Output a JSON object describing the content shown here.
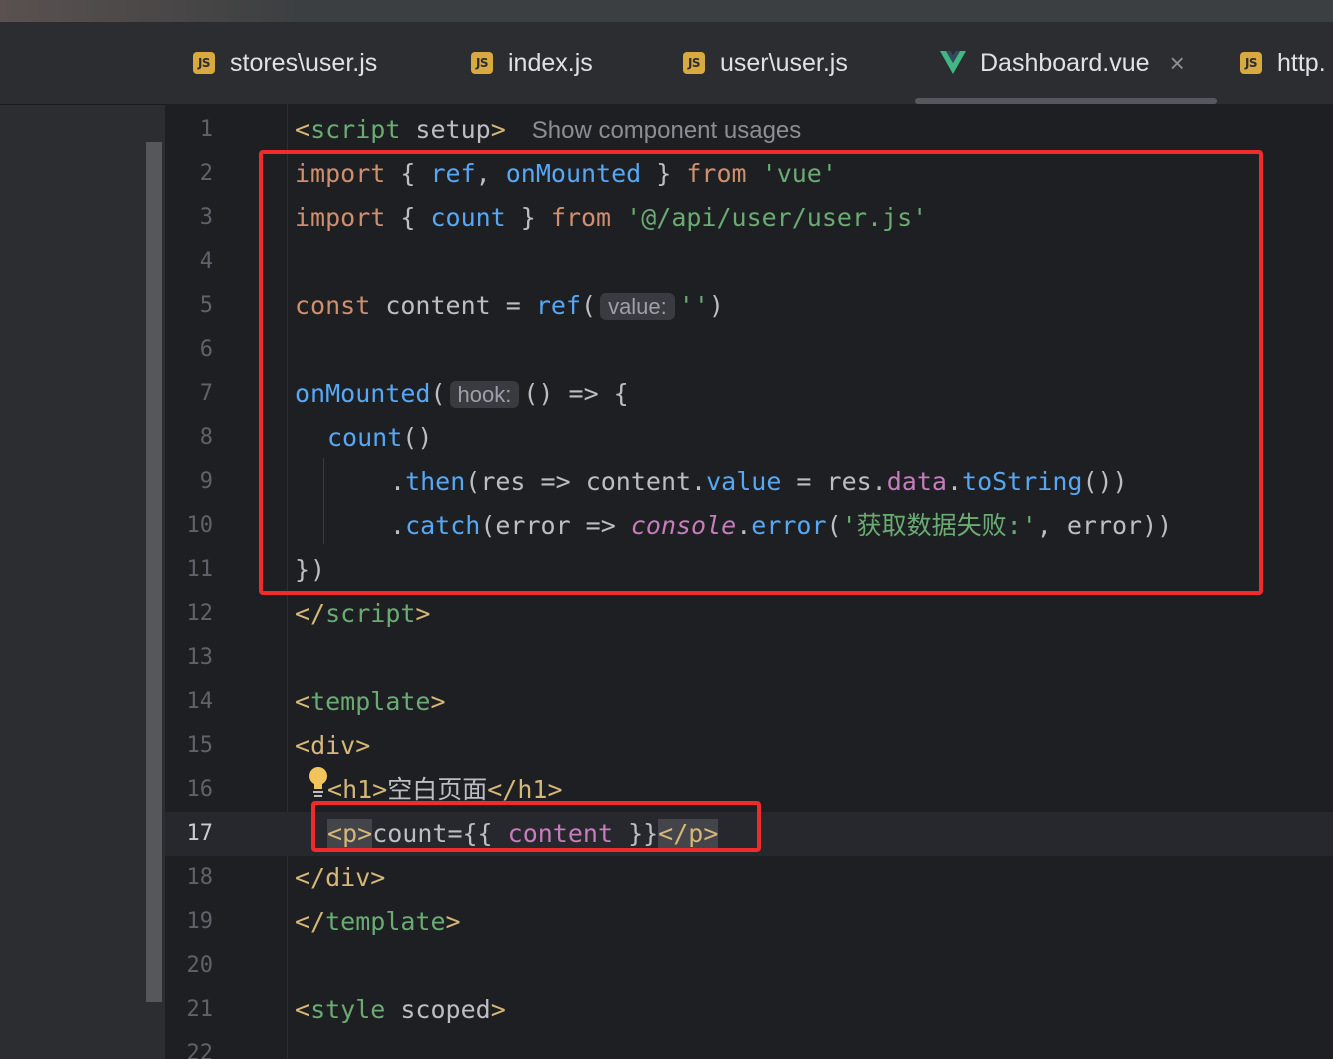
{
  "tabs": [
    {
      "label": "stores\\user.js",
      "icon": "js-file-icon",
      "active": false
    },
    {
      "label": "index.js",
      "icon": "js-file-icon",
      "active": false
    },
    {
      "label": "user\\user.js",
      "icon": "js-file-icon",
      "active": false
    },
    {
      "label": "Dashboard.vue",
      "icon": "vue-file-icon",
      "active": true
    },
    {
      "label": "http.",
      "icon": "js-file-icon",
      "active": false
    }
  ],
  "tab_close_glyph": "×",
  "js_badge": "JS",
  "inlay": {
    "usages": "Show component usages",
    "value": "value:",
    "hook": "hook:"
  },
  "line_numbers": [
    "1",
    "2",
    "3",
    "4",
    "5",
    "6",
    "7",
    "8",
    "9",
    "10",
    "11",
    "12",
    "13",
    "14",
    "15",
    "16",
    "17",
    "18",
    "19",
    "20",
    "21",
    "22"
  ],
  "current_line": "17",
  "code": {
    "l1": {
      "open": "<",
      "tag": "script",
      "attr": " setup",
      "close": ">"
    },
    "l2": {
      "kw1": "import",
      "p1": " { ",
      "f1": "ref",
      "p2": ", ",
      "f2": "onMounted",
      "p3": " } ",
      "kw2": "from",
      "p4": " ",
      "s1": "'vue'"
    },
    "l3": {
      "kw1": "import",
      "p1": " { ",
      "f1": "count",
      "p2": " } ",
      "kw2": "from",
      "p3": " ",
      "s1": "'@/api/user/user.js'"
    },
    "l5": {
      "kw1": "const",
      "p1": " content = ",
      "f1": "ref",
      "p2": "(",
      "s1": "''",
      "p3": ")"
    },
    "l7": {
      "f1": "onMounted",
      "p1": "(",
      "p2": "() => {"
    },
    "l8": {
      "f1": "count",
      "p1": "()"
    },
    "l9": {
      "p1": ".",
      "f1": "then",
      "p2": "(res => content.",
      "f2": "value",
      "p3": " = res.",
      "m1": "data",
      "p4": ".",
      "f3": "toString",
      "p5": "())"
    },
    "l10": {
      "p1": ".",
      "f1": "catch",
      "p2": "(error => ",
      "i1": "console",
      "p3": ".",
      "f2": "error",
      "p4": "(",
      "s1": "'获取数据失败:'",
      "p5": ", error))"
    },
    "l11": {
      "p1": "})"
    },
    "l12": {
      "open": "</",
      "tag": "script",
      "close": ">"
    },
    "l14": {
      "open": "<",
      "tag": "template",
      "close": ">"
    },
    "l15": {
      "open": "<",
      "tag": "div",
      "close": ">"
    },
    "l16": {
      "o1": "<",
      "t1": "h1",
      "c1": ">",
      "text": "空白页面",
      "o2": "</",
      "t2": "h1",
      "c2": ">"
    },
    "l17": {
      "o1": "<",
      "t1": "p",
      "c1": ">",
      "text": "count={{ ",
      "m1": "content",
      "text2": " }}",
      "o2": "</",
      "t2": "p",
      "c2": ">"
    },
    "l18": {
      "open": "</",
      "tag": "div",
      "close": ">"
    },
    "l19": {
      "open": "</",
      "tag": "template",
      "close": ">"
    },
    "l21": {
      "open": "<",
      "tag": "style",
      "attr": " scoped",
      "close": ">"
    }
  },
  "colors": {
    "highlight_box": "#ef2b2b",
    "keyword": "#cf8e6d",
    "function": "#56a8f5",
    "string": "#6aab73",
    "tag": "#d5b778"
  }
}
